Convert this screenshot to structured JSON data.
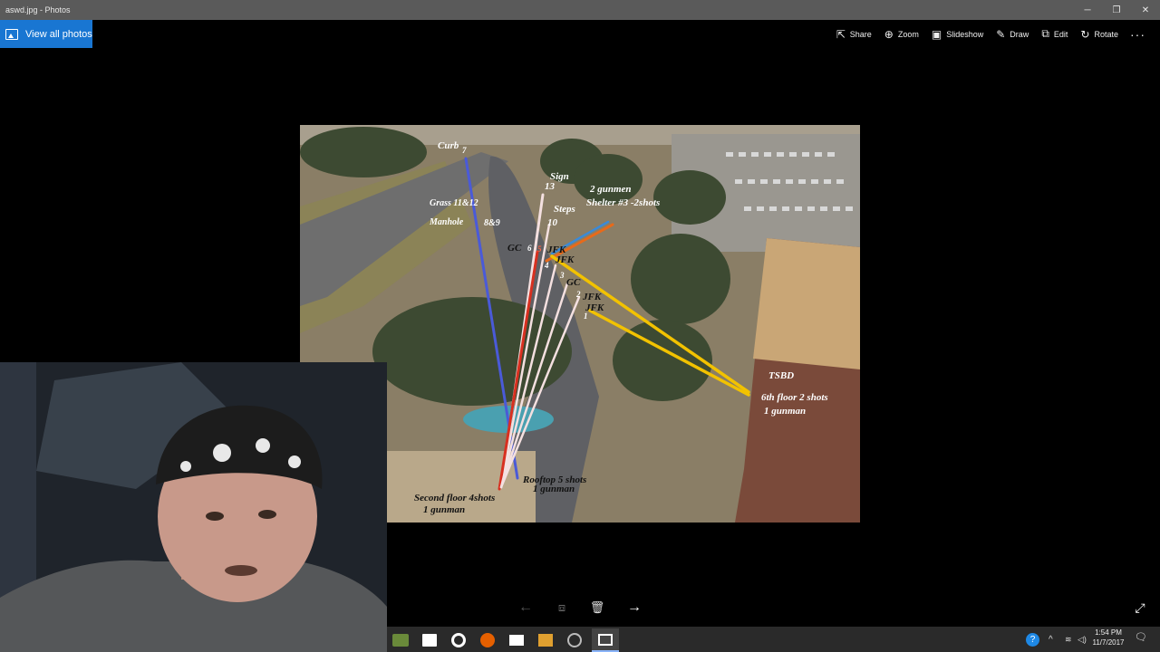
{
  "window": {
    "title": "aswd.jpg - Photos",
    "minimize_glyph": "─",
    "maximize_glyph": "❐",
    "close_glyph": "✕"
  },
  "appbar": {
    "view_all": "View all photos",
    "toolbar": [
      {
        "label": "Share",
        "icon": "share-icon",
        "glyph": "⇱"
      },
      {
        "label": "Zoom",
        "icon": "zoom-icon",
        "glyph": "⊕"
      },
      {
        "label": "Slideshow",
        "icon": "slideshow-icon",
        "glyph": "▣"
      },
      {
        "label": "Draw",
        "icon": "draw-icon",
        "glyph": "✎"
      },
      {
        "label": "Edit",
        "icon": "edit-icon",
        "glyph": "⧉"
      },
      {
        "label": "Rotate",
        "icon": "rotate-icon",
        "glyph": "↻"
      }
    ],
    "more": "···"
  },
  "photo": {
    "labels": {
      "curb": "Curb",
      "curb_num": "7",
      "sign": "Sign",
      "sign_num": "13",
      "grass": "Grass 11&12",
      "steps": "Steps",
      "steps_num": "10",
      "manhole": "Manhole",
      "manhole_num": "8&9",
      "gunmen": "2 gunmen",
      "shelter": "Shelter #3 -2shots",
      "gc1": "GC",
      "num6": "6",
      "num5": "5",
      "jfk1": "JFK",
      "jfk2": "JFK",
      "num4": "4",
      "num3": "3",
      "gc2": "GC",
      "num2": "2",
      "jfk3": "JFK",
      "jfk4": "JFK",
      "num1": "1",
      "tsbd": "TSBD",
      "sixth": "6th floor 2 shots",
      "sixth_gunman": "1 gunman",
      "rooftop": "Rooftop 5 shots",
      "rooftop_gunman": "1 gunman",
      "second": "Second floor 4shots",
      "second_gunman": "1 gunman"
    }
  },
  "nav": {
    "prev": "←",
    "film": "⧈",
    "delete": "🗑",
    "next": "→",
    "fullscreen": "⤢"
  },
  "taskbar": {
    "clock_time": "1:54 PM",
    "clock_date": "11/7/2017",
    "tray_chevron": "^",
    "notification": "🗨"
  },
  "colors": {
    "accent": "#1976d2",
    "line_yellow": "#f2c200",
    "line_blue": "#4a5ad8",
    "line_orange": "#e86a1a",
    "line_white": "#f4e0e0",
    "line_red": "#d83020"
  }
}
